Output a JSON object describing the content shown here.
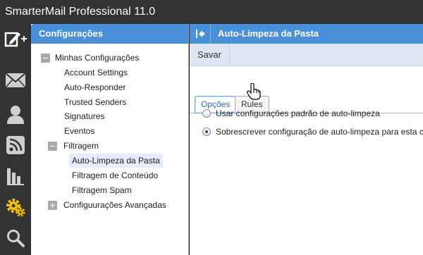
{
  "app": {
    "title": "SmarterMail Professional 11.0"
  },
  "nav_icons": [
    "compose-icon",
    "mail-icon",
    "contacts-icon",
    "rss-icon",
    "reports-icon",
    "settings-icon",
    "search-icon"
  ],
  "tree": {
    "header": "Configurações",
    "minhas": "Minhas Configurações",
    "account_settings": "Account Settings",
    "auto_responder": "Auto-Responder",
    "trusted_senders": "Trusted Senders",
    "signatures": "Signatures",
    "eventos": "Eventos",
    "filtragem": "Filtragem",
    "auto_limpeza": "Auto-Limpeza da Pasta",
    "filtragem_conteudo": "Filtragem de Conteúdo",
    "filtragem_spam": "Filtragem Spam",
    "avancadas": "Configuurações Avançadas"
  },
  "content": {
    "title": "Auto-Limpeza da Pasta",
    "save_label": "Savar",
    "tabs": [
      {
        "label": "Opções",
        "active": true
      },
      {
        "label": "Rules",
        "active": false
      }
    ],
    "options": [
      {
        "label": "Usar configurações padrão de auto-limpeza",
        "checked": false
      },
      {
        "label": "Sobrescrever configuração de auto-limpeza para esta conta",
        "checked": true
      }
    ]
  },
  "colors": {
    "accent": "#4a90d9",
    "toolbar": "#dce7f3",
    "settings_icon": "#f5c400"
  }
}
